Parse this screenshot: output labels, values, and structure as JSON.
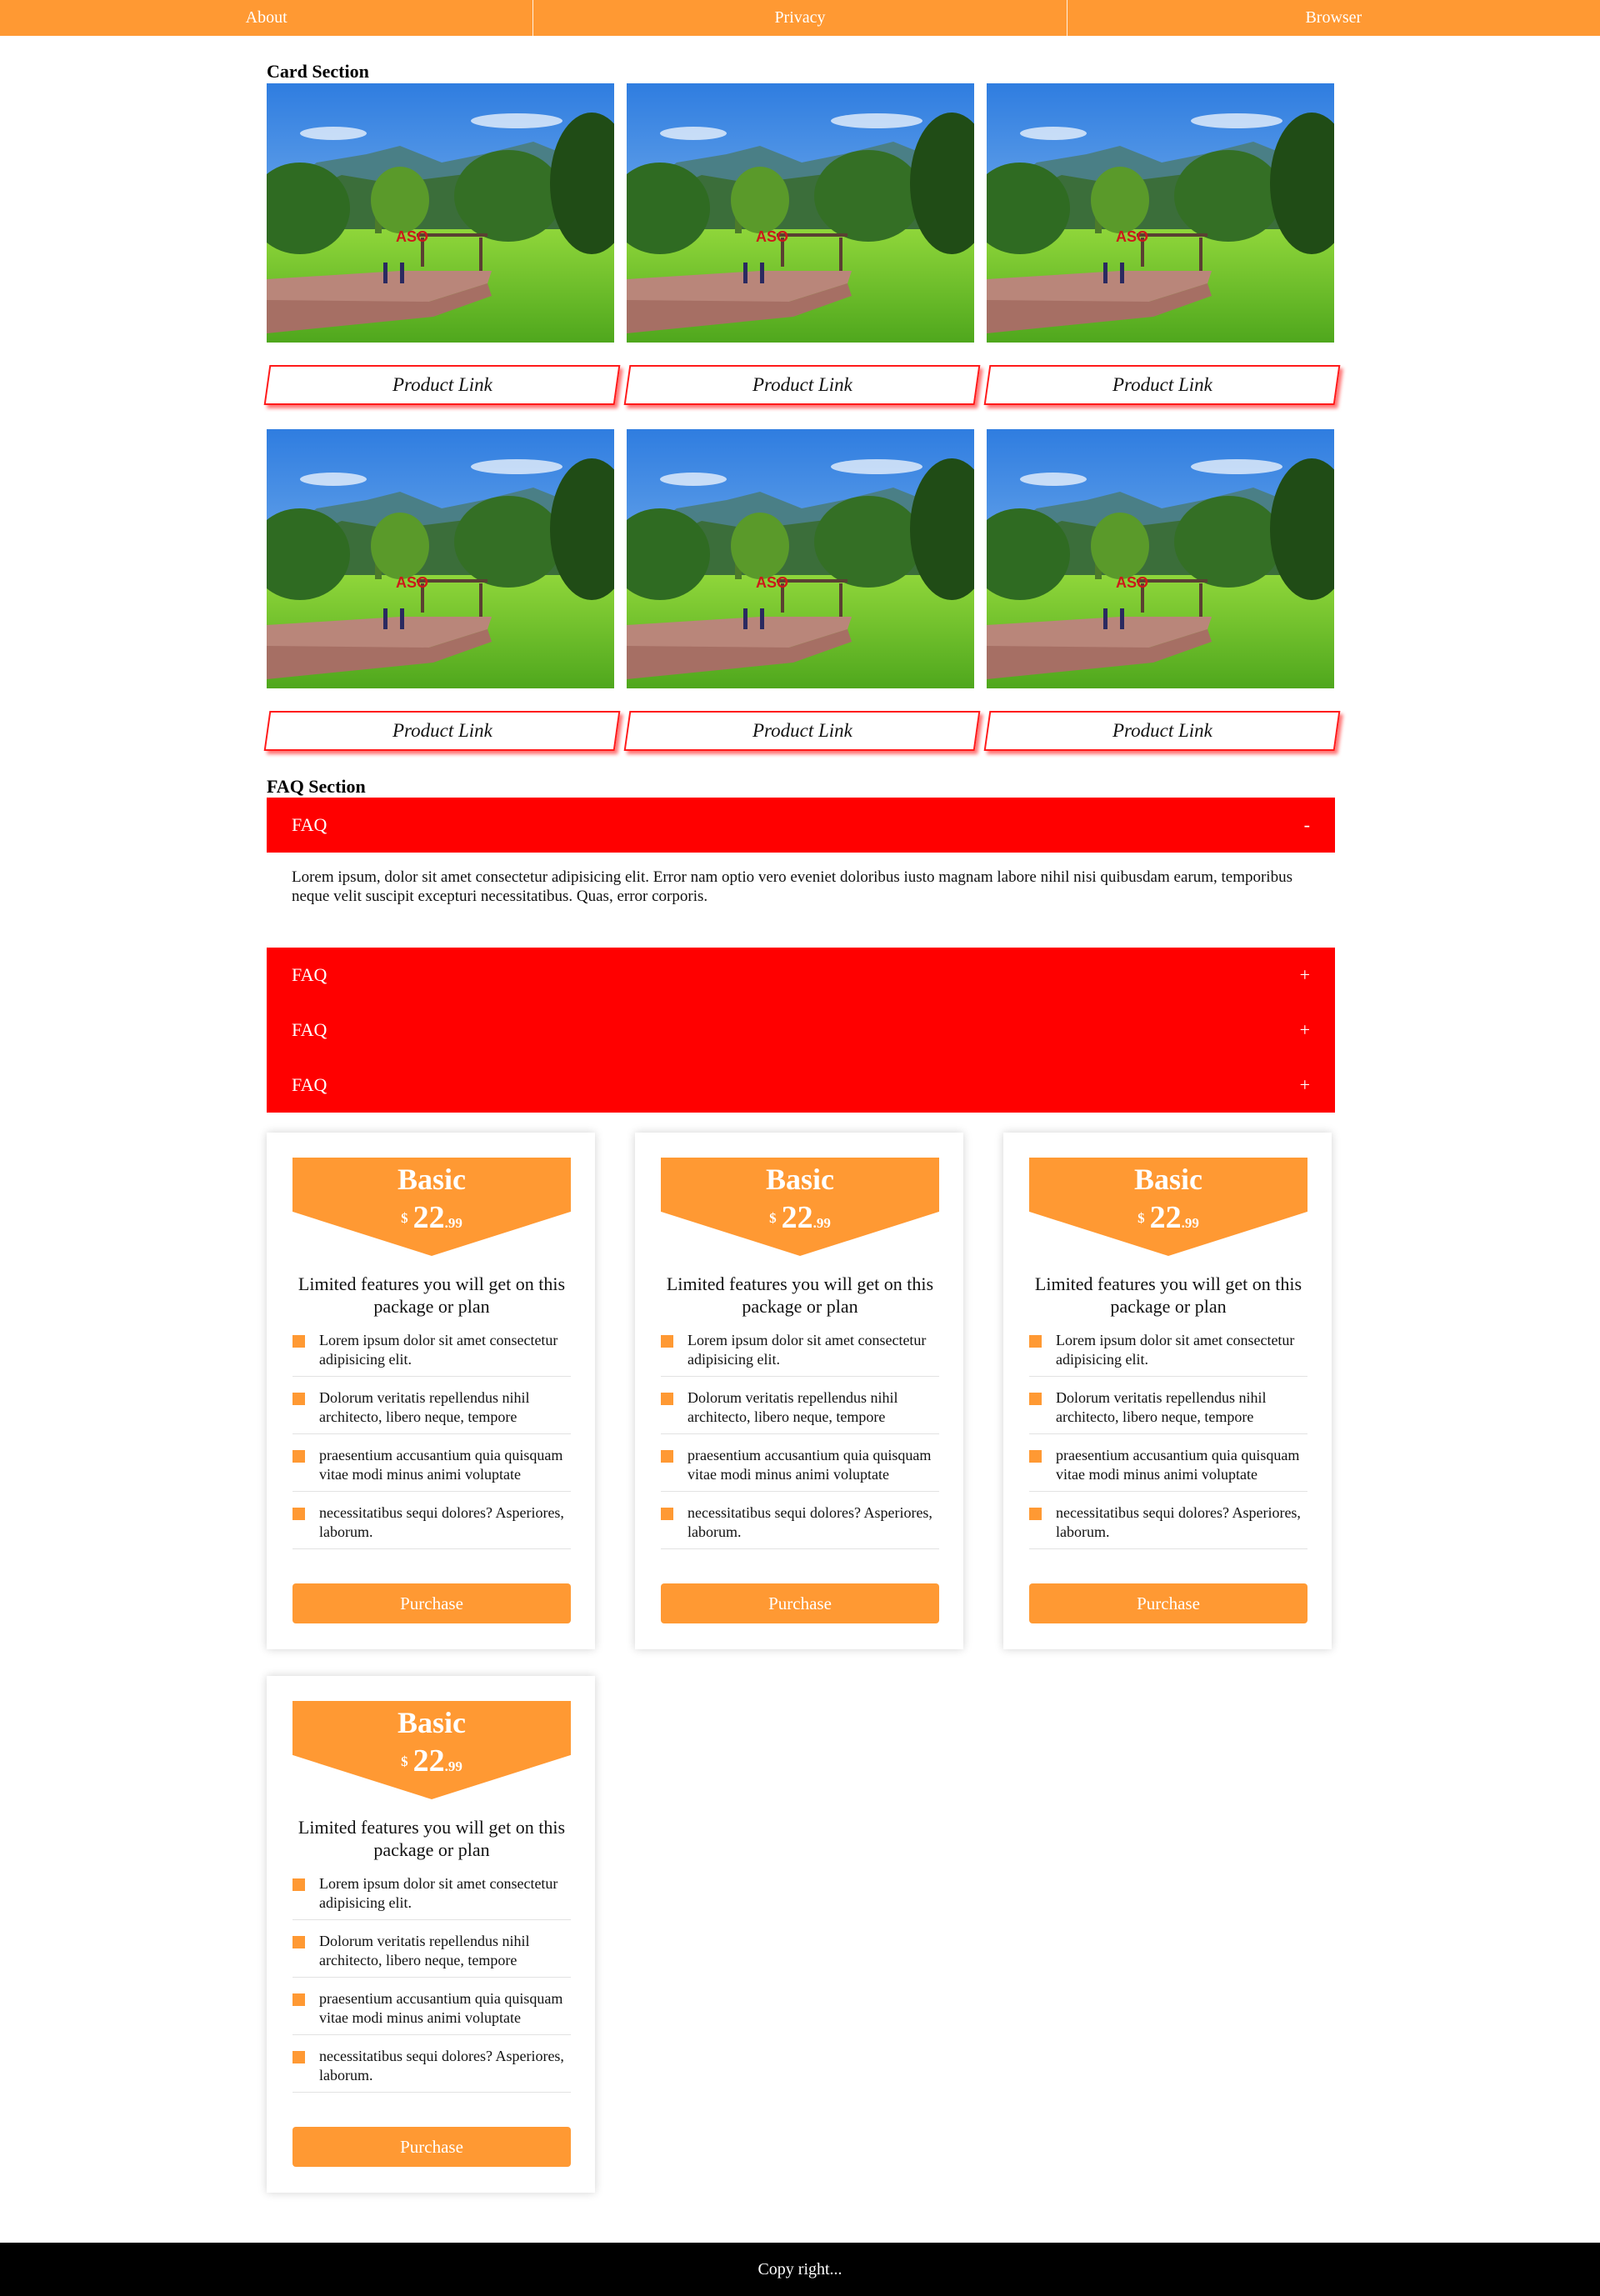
{
  "nav": {
    "items": [
      "About",
      "Privacy",
      "Browser"
    ]
  },
  "card_section": {
    "title": "Card Section",
    "cards": [
      {
        "link_label": "Product Link"
      },
      {
        "link_label": "Product Link"
      },
      {
        "link_label": "Product Link"
      },
      {
        "link_label": "Product Link"
      },
      {
        "link_label": "Product Link"
      },
      {
        "link_label": "Product Link"
      }
    ]
  },
  "faq_section": {
    "title": "FAQ Section",
    "items": [
      {
        "question": "FAQ",
        "toggle": "-",
        "answer": "Lorem ipsum, dolor sit amet consectetur adipisicing elit. Error nam optio vero eveniet doloribus iusto magnam labore nihil nisi quibusdam earum, temporibus neque velit suscipit excepturi necessitatibus. Quas, error corporis."
      },
      {
        "question": "FAQ",
        "toggle": "+"
      },
      {
        "question": "FAQ",
        "toggle": "+"
      },
      {
        "question": "FAQ",
        "toggle": "+"
      }
    ]
  },
  "pricing": {
    "plans": [
      {
        "name": "Basic",
        "currency": "$",
        "amount": "22",
        "cents": ".99",
        "description": "Limited features you will get on this package or plan",
        "features": [
          "Lorem ipsum dolor sit amet consectetur adipisicing elit.",
          "Dolorum veritatis repellendus nihil architecto, libero neque, tempore",
          "praesentium accusantium quia quisquam vitae modi minus animi voluptate",
          "necessitatibus sequi dolores? Asperiores, laborum."
        ],
        "button": "Purchase"
      },
      {
        "name": "Basic",
        "currency": "$",
        "amount": "22",
        "cents": ".99",
        "description": "Limited features you will get on this package or plan",
        "features": [
          "Lorem ipsum dolor sit amet consectetur adipisicing elit.",
          "Dolorum veritatis repellendus nihil architecto, libero neque, tempore",
          "praesentium accusantium quia quisquam vitae modi minus animi voluptate",
          "necessitatibus sequi dolores? Asperiores, laborum."
        ],
        "button": "Purchase"
      },
      {
        "name": "Basic",
        "currency": "$",
        "amount": "22",
        "cents": ".99",
        "description": "Limited features you will get on this package or plan",
        "features": [
          "Lorem ipsum dolor sit amet consectetur adipisicing elit.",
          "Dolorum veritatis repellendus nihil architecto, libero neque, tempore",
          "praesentium accusantium quia quisquam vitae modi minus animi voluptate",
          "necessitatibus sequi dolores? Asperiores, laborum."
        ],
        "button": "Purchase"
      },
      {
        "name": "Basic",
        "currency": "$",
        "amount": "22",
        "cents": ".99",
        "description": "Limited features you will get on this package or plan",
        "features": [
          "Lorem ipsum dolor sit amet consectetur adipisicing elit.",
          "Dolorum veritatis repellendus nihil architecto, libero neque, tempore",
          "praesentium accusantium quia quisquam vitae modi minus animi voluptate",
          "necessitatibus sequi dolores? Asperiores, laborum."
        ],
        "button": "Purchase"
      }
    ]
  },
  "footer": {
    "text": "Copy right..."
  },
  "colors": {
    "accent": "#ff9933",
    "faq_bg": "#ff0000",
    "footer_bg": "#000000"
  }
}
